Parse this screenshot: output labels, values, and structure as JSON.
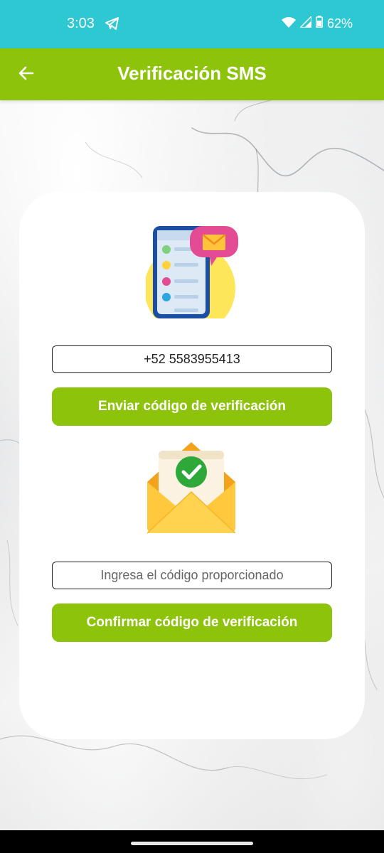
{
  "status_bar": {
    "time": "3:03",
    "battery_percent": "62%",
    "icons": [
      "telegram-icon",
      "wifi-icon",
      "signal-icon",
      "battery-icon"
    ]
  },
  "app_bar": {
    "title": "Verificación SMS",
    "back_icon": "arrow-back-icon"
  },
  "form": {
    "phone_value": "+52 5583955413",
    "send_button_label": "Enviar código de verificación",
    "code_placeholder": "Ingresa el código proporcionado",
    "code_value": "",
    "confirm_button_label": "Confirmar código de verificación"
  },
  "colors": {
    "status_bar": "#2ec8d3",
    "accent": "#8dc30b",
    "card": "#ffffff"
  }
}
